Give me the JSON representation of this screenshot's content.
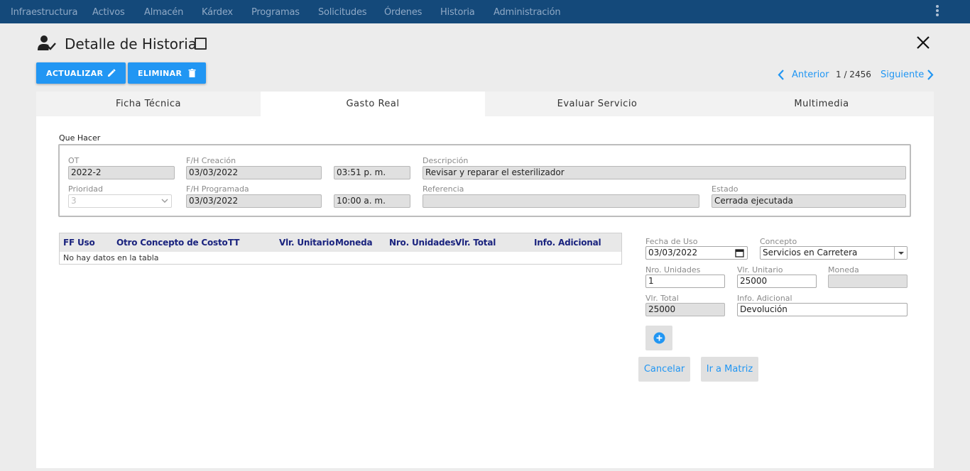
{
  "nav": {
    "items": [
      "Infraestructura",
      "Activos",
      "Almacén",
      "Kárdex",
      "Programas",
      "Solicitudes",
      "Órdenes",
      "Historia",
      "Administración"
    ]
  },
  "header": {
    "title": "Detalle de Historia",
    "actualizar_label": "ACTUALIZAR",
    "eliminar_label": "ELIMINAR"
  },
  "pager": {
    "prev_label": "Anterior",
    "count": "1 / 2456",
    "next_label": "Siguiente"
  },
  "tabs": [
    "Ficha Técnica",
    "Gasto Real",
    "Evaluar Servicio",
    "Multimedia"
  ],
  "que_hacer": {
    "section_label": "Que Hacer",
    "ot_label": "OT",
    "ot_value": "2022-2",
    "fh_creacion_label": "F/H Creación",
    "fh_creacion_date": "03/03/2022",
    "fh_creacion_time": "03:51  p. m.",
    "descripcion_label": "Descripción",
    "descripcion_value": "Revisar y reparar el esterilizador",
    "prioridad_label": "Prioridad",
    "prioridad_value": "3",
    "fh_programada_label": "F/H Programada",
    "fh_programada_date": "03/03/2022",
    "fh_programada_time": "10:00  a. m.",
    "referencia_label": "Referencia",
    "referencia_value": "",
    "estado_label": "Estado",
    "estado_value": "Cerrada ejecutada"
  },
  "table": {
    "columns": [
      "FF Uso",
      "Otro Concepto de Costo",
      "TT",
      "Vlr. Unitario",
      "Moneda",
      "Nro. Unidades",
      "Vlr. Total",
      "Info. Adicional"
    ],
    "empty_text": "No hay datos en la tabla"
  },
  "form": {
    "fecha_uso_label": "Fecha de Uso",
    "fecha_uso_value": "03/03/2022",
    "concepto_label": "Concepto",
    "concepto_value": "Servicios en Carretera",
    "nro_unidades_label": "Nro. Unidades",
    "nro_unidades_value": "1",
    "vlr_unitario_label": "Vlr. Unitario",
    "vlr_unitario_value": "25000",
    "moneda_label": "Moneda",
    "moneda_value": "",
    "vlr_total_label": "Vlr. Total",
    "vlr_total_value": "25000",
    "info_adicional_label": "Info. Adicional",
    "info_adicional_value": "Devolución",
    "cancelar_label": "Cancelar",
    "ir_matriz_label": "Ir a Matriz"
  },
  "colors": {
    "nav_bg": "#14497a",
    "accent": "#2196f3",
    "header_text": "#1a237e"
  },
  "icons": [
    "more-vert-icon",
    "user-check-icon",
    "close-icon",
    "edit-icon",
    "trash-icon",
    "chevron-left-icon",
    "chevron-right-icon",
    "calendar-icon",
    "dropdown-icon",
    "add-circle-icon"
  ]
}
